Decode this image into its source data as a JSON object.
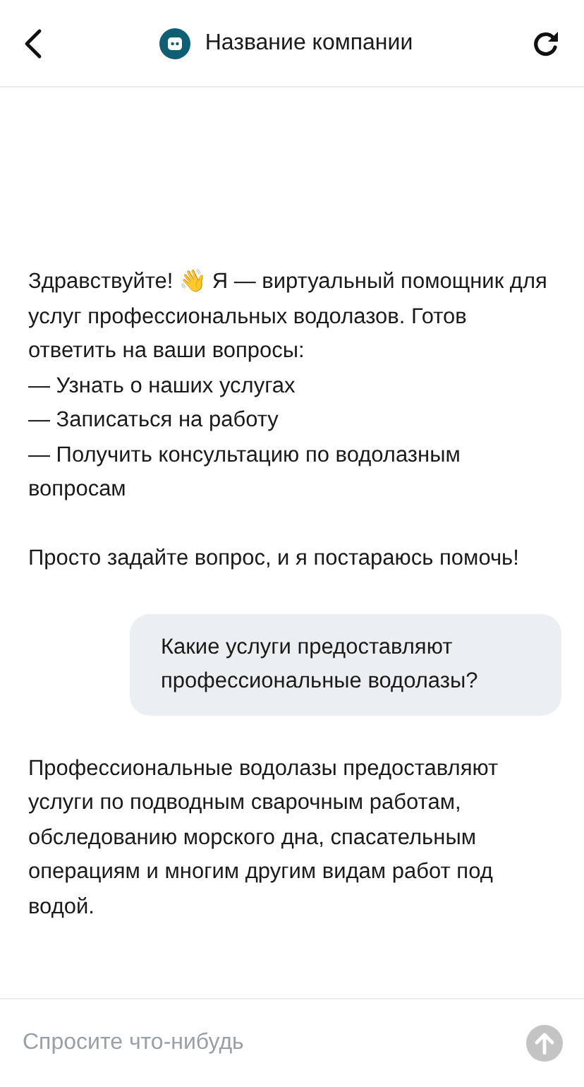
{
  "header": {
    "title": "Название компании"
  },
  "messages": [
    {
      "kind": "bot",
      "paragraphs": [
        "Здравствуйте! 👋 Я — виртуальный помощник для услуг профессиональных водолазов. Готов ответить на ваши вопросы:\n— Узнать о наших услугах\n— Записаться на работу\n— Получить консультацию по водолазным вопросам",
        "Просто задайте вопрос, и я постараюсь помочь!"
      ]
    },
    {
      "kind": "user",
      "paragraphs": [
        "Какие услуги предоставляют профессиональные водолазы?"
      ]
    },
    {
      "kind": "bot",
      "paragraphs": [
        "Профессиональные водолазы предоставляют услуги по подводным сварочным работам, обследованию морского дна, спасательным операциям и многим другим видам работ под водой."
      ]
    }
  ],
  "composer": {
    "placeholder": "Спросите что-нибудь"
  }
}
